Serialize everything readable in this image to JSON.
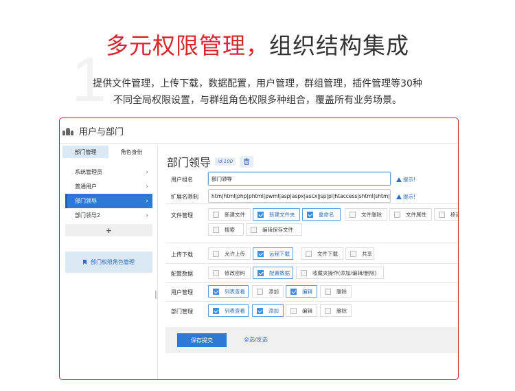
{
  "background_number": "1",
  "headline": {
    "red": "多元权限管理，",
    "dark": "组织结构集成"
  },
  "subtitle": {
    "line1": "提供文件管理，上传下载，数据配置，用户管理，群组管理，插件管理等30种",
    "line2": "不同全局权限设置，与群组角色权限多种组合，覆盖所有业务场景。"
  },
  "window": {
    "title": "用户与部门",
    "title_icon": "users-icon"
  },
  "sidebar": {
    "tabs": [
      {
        "label": "部门管理",
        "active": true
      },
      {
        "label": "角色身份",
        "active": false
      }
    ],
    "items": [
      {
        "label": "系统管理员",
        "active": false
      },
      {
        "label": "普通用户",
        "active": false
      },
      {
        "label": "部门领导",
        "active": true
      },
      {
        "label": "部门领导2",
        "active": false
      }
    ],
    "add_label": "+",
    "bookmark_label": "部门权限角色管理"
  },
  "main": {
    "title": "部门领导",
    "id_badge": "id:100",
    "fields": {
      "name_label": "用户组名",
      "name_value": "部门领导",
      "ext_label": "扩展名限制",
      "ext_value": "htm|html|php|phtml|pwml|asp|aspx|ascx|jsp|pl|htaccess|shtml|shtm|phtm",
      "hint_label": "提示!"
    },
    "sections": [
      {
        "label": "文件管理",
        "options": [
          {
            "label": "新建文件",
            "checked": false
          },
          {
            "label": "新建文件夹",
            "checked": true
          },
          {
            "label": "重命名",
            "checked": true
          },
          {
            "label": "文件删除",
            "checked": false
          },
          {
            "label": "文件属性",
            "checked": false
          },
          {
            "label": "移动",
            "checked": false
          },
          {
            "label": "搜索",
            "checked": false
          },
          {
            "label": "编辑保存文件",
            "checked": false
          }
        ]
      },
      {
        "label": "上传下载",
        "options": [
          {
            "label": "允许上传",
            "checked": false
          },
          {
            "label": "远程下载",
            "checked": true
          },
          {
            "label": "文件下载",
            "checked": false
          },
          {
            "label": "共享",
            "checked": false
          }
        ]
      },
      {
        "label": "配置数据",
        "options": [
          {
            "label": "修改密码",
            "checked": false
          },
          {
            "label": "配置数据",
            "checked": true
          },
          {
            "label": "收藏夹操作(添加/编辑/删除)",
            "checked": false
          }
        ]
      },
      {
        "label": "用户管理",
        "options": [
          {
            "label": "列表查看",
            "checked": true
          },
          {
            "label": "添加",
            "checked": false
          },
          {
            "label": "编辑",
            "checked": true
          },
          {
            "label": "删除",
            "checked": false
          }
        ]
      },
      {
        "label": "部门管理",
        "options": [
          {
            "label": "列表查看",
            "checked": true
          },
          {
            "label": "添加",
            "checked": true
          },
          {
            "label": "编辑",
            "checked": false
          },
          {
            "label": "删除",
            "checked": false
          }
        ]
      }
    ],
    "save_label": "保存提交",
    "toggle_label": "全选/反选"
  },
  "colors": {
    "accent_red": "#d7282d",
    "primary_blue": "#2c7ad6",
    "light_blue": "#dbe9f5"
  }
}
